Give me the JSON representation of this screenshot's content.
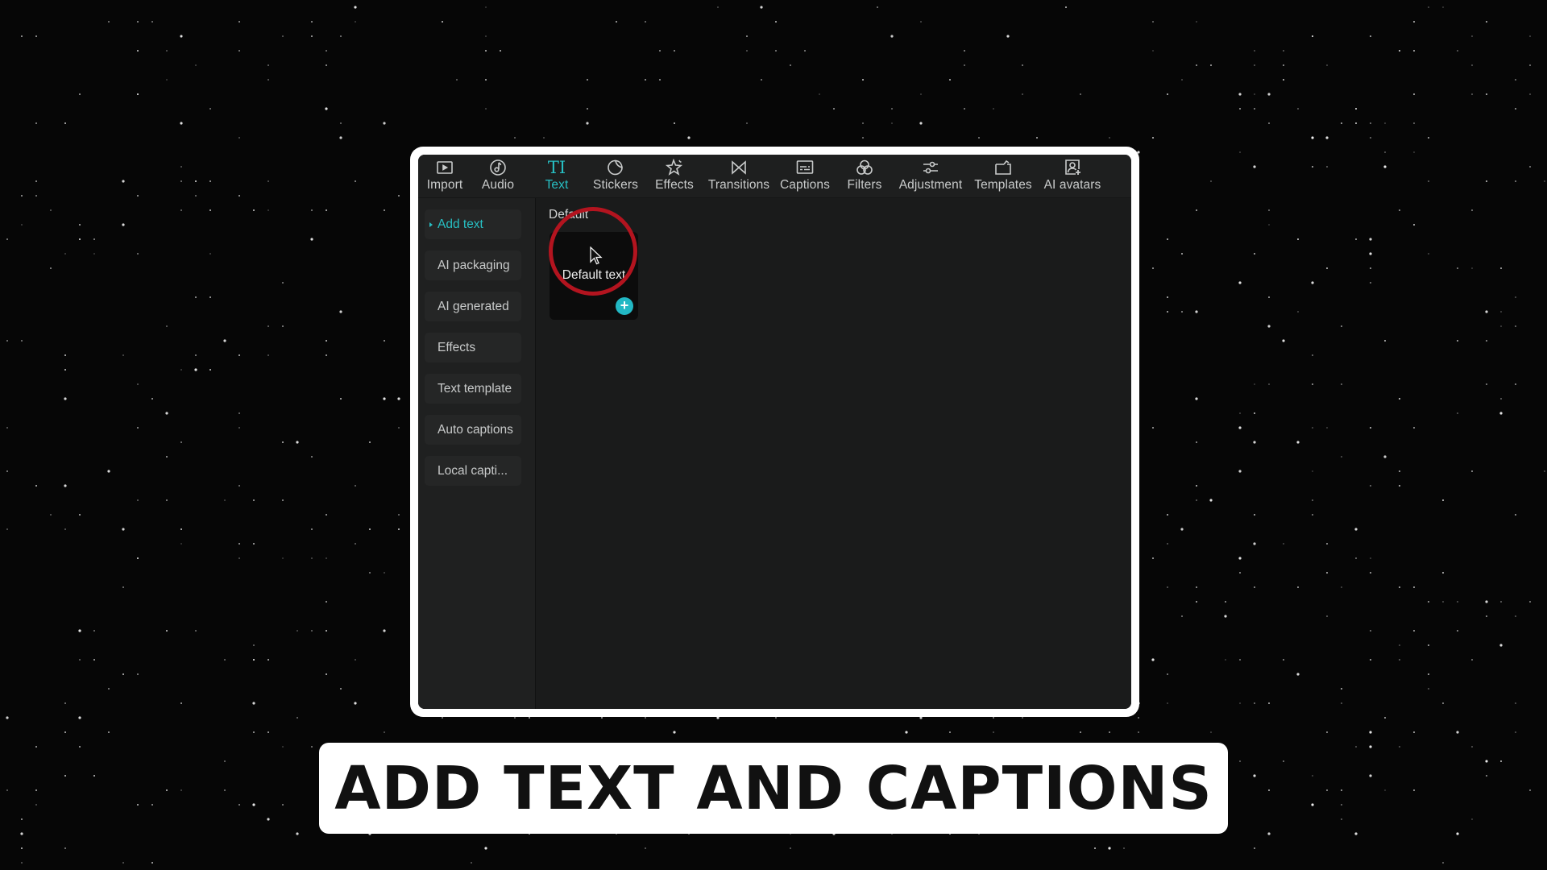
{
  "toolbar": {
    "items": [
      {
        "label": "Import",
        "icon": "import-icon",
        "active": false
      },
      {
        "label": "Audio",
        "icon": "audio-icon",
        "active": false
      },
      {
        "label": "Text",
        "icon": "text-icon",
        "glyph": "TI",
        "active": true
      },
      {
        "label": "Stickers",
        "icon": "stickers-icon",
        "active": false
      },
      {
        "label": "Effects",
        "icon": "effects-icon",
        "active": false
      },
      {
        "label": "Transitions",
        "icon": "transitions-icon",
        "active": false
      },
      {
        "label": "Captions",
        "icon": "captions-icon",
        "active": false
      },
      {
        "label": "Filters",
        "icon": "filters-icon",
        "active": false
      },
      {
        "label": "Adjustment",
        "icon": "adjustment-icon",
        "active": false
      },
      {
        "label": "Templates",
        "icon": "templates-icon",
        "active": false
      },
      {
        "label": "AI avatars",
        "icon": "ai-avatars-icon",
        "active": false
      }
    ]
  },
  "sidebar": {
    "items": [
      {
        "label": "Add text",
        "active": true
      },
      {
        "label": "AI packaging",
        "active": false
      },
      {
        "label": "AI generated",
        "active": false
      },
      {
        "label": "Effects",
        "active": false
      },
      {
        "label": "Text template",
        "active": false
      },
      {
        "label": "Auto captions",
        "active": false
      },
      {
        "label": "Local capti...",
        "active": false
      }
    ]
  },
  "content": {
    "section_label": "Default",
    "card": {
      "text": "Default text",
      "add_icon": "plus-icon",
      "add_symbol": "+"
    }
  },
  "banner": {
    "title": "ADD TEXT AND CAPTIONS"
  },
  "colors": {
    "accent": "#27bfc3",
    "highlight_ring": "#b3141f",
    "panel_bg": "#1b1c1c",
    "background": "#060606"
  }
}
